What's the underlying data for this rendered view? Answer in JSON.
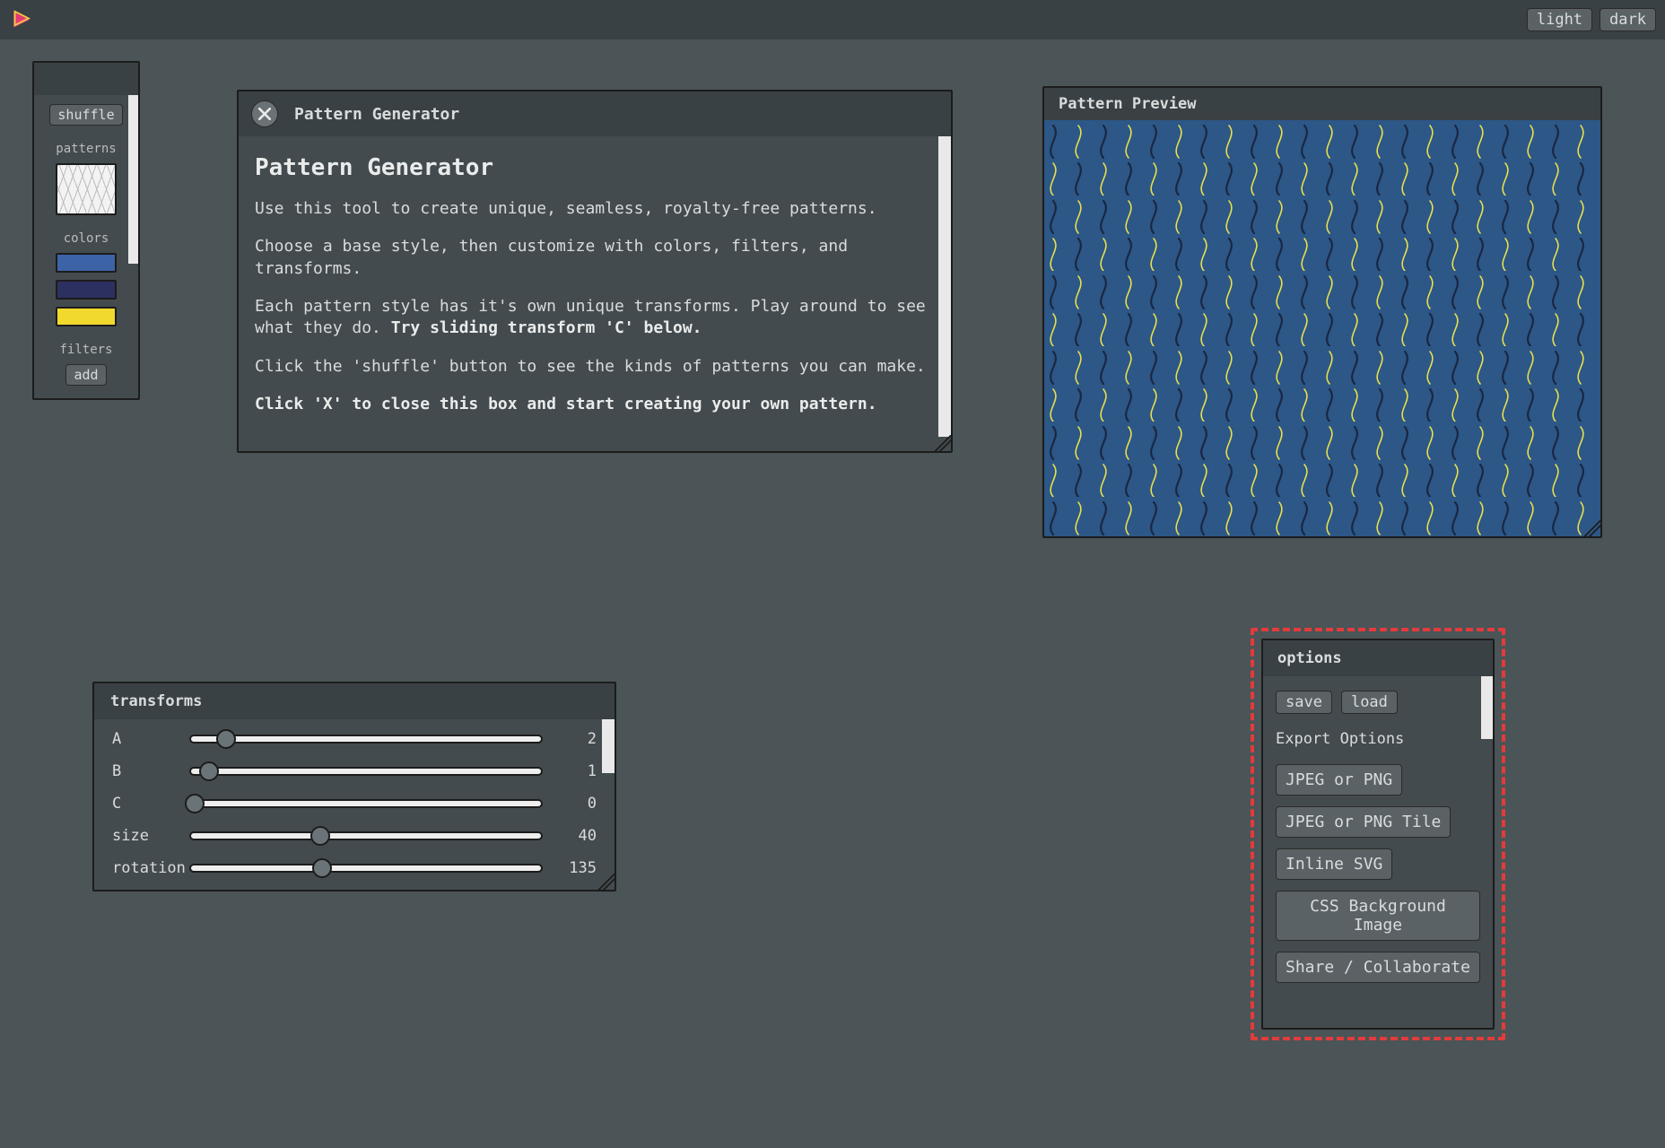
{
  "topbar": {
    "light_label": "light",
    "dark_label": "dark"
  },
  "palette": {
    "shuffle_label": "shuffle",
    "patterns_label": "patterns",
    "colors_label": "colors",
    "filters_label": "filters",
    "add_label": "add",
    "colors": [
      "#3c63a5",
      "#2c3060",
      "#f2d92e"
    ]
  },
  "intro": {
    "header_title": "Pattern Generator",
    "heading": "Pattern Generator",
    "p1": "Use this tool to create unique, seamless, royalty-free patterns.",
    "p2": "Choose a base style, then customize with colors, filters, and transforms.",
    "p3a": "Each pattern style has it's own unique transforms. Play around to see what they do. ",
    "p3b": "Try sliding transform 'C' below.",
    "p4": "Click the 'shuffle' button to see the kinds of patterns you can make.",
    "p5": "Click 'X' to close this box and start creating your own pattern."
  },
  "preview": {
    "title": "Pattern Preview"
  },
  "transforms": {
    "title": "transforms",
    "sliders": [
      {
        "label": "A",
        "value": 2,
        "pct": 10
      },
      {
        "label": "B",
        "value": 1,
        "pct": 5
      },
      {
        "label": "C",
        "value": 0,
        "pct": 1
      },
      {
        "label": "size",
        "value": 40,
        "pct": 37
      },
      {
        "label": "rotation",
        "value": 135,
        "pct": 37.5
      }
    ]
  },
  "options": {
    "title": "options",
    "save_label": "save",
    "load_label": "load",
    "export_heading": "Export Options",
    "exports": [
      "JPEG or PNG",
      "JPEG or PNG Tile",
      "Inline SVG",
      "CSS Background Image",
      "Share / Collaborate"
    ]
  }
}
